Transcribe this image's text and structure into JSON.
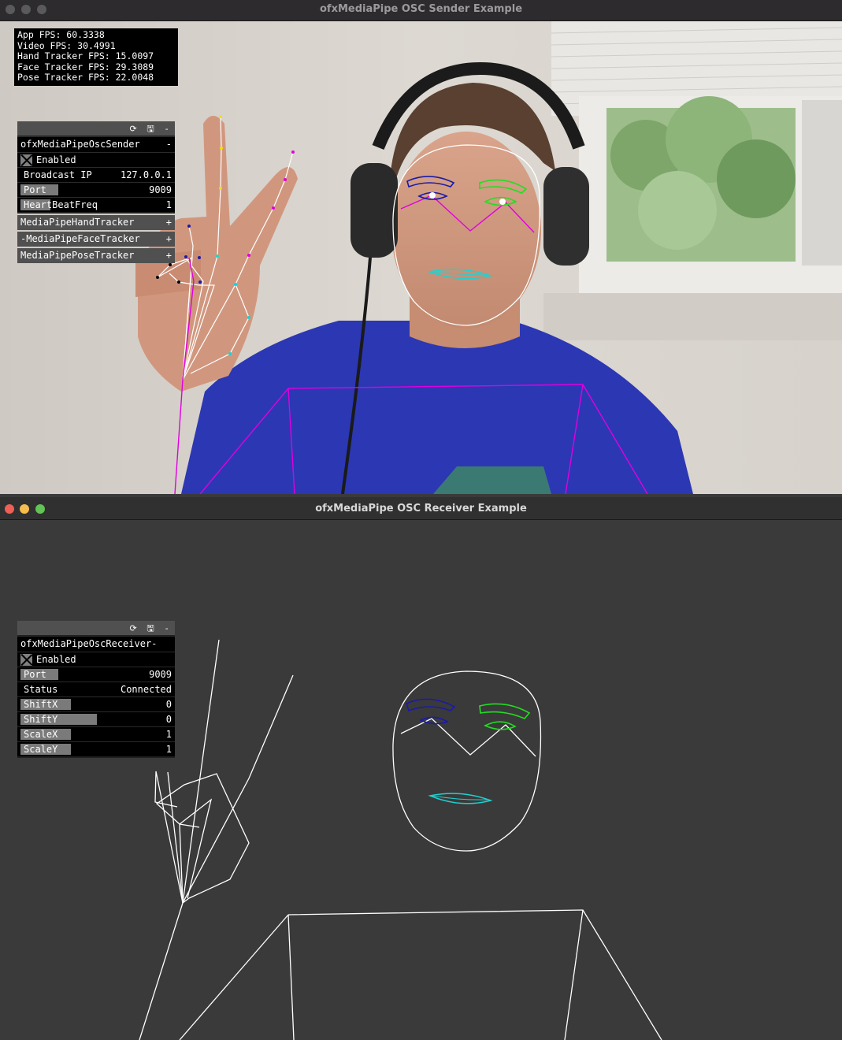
{
  "sender": {
    "title": "ofxMediaPipe OSC Sender Example",
    "fps": [
      "App FPS: 60.3338",
      "Video FPS: 30.4991",
      "Hand Tracker FPS: 15.0097",
      "Face Tracker FPS: 29.3089",
      "Pose Tracker FPS: 22.0048"
    ],
    "gui": {
      "header_icons": "⟳ 🖫 -",
      "panel_name": "ofxMediaPipeOscSender",
      "panel_mark": "-",
      "enabled_label": "Enabled",
      "broadcast_label": "Broadcast IP",
      "broadcast_value": "127.0.0.1",
      "port_label": "Port",
      "port_value": "9009",
      "heartbeat_label": "HeartBeatFreq",
      "heartbeat_value": "1",
      "groups": [
        {
          "label": "MediaPipeHandTracker",
          "mark": "+"
        },
        {
          "label": "-MediaPipeFaceTracker",
          "mark": "+"
        },
        {
          "label": "MediaPipePoseTracker",
          "mark": "+"
        }
      ]
    }
  },
  "receiver": {
    "title": "ofxMediaPipe OSC Receiver Example",
    "gui": {
      "header_icons": "⟳ 🖫 -",
      "panel_name": "ofxMediaPipeOscReceiver-",
      "enabled_label": "Enabled",
      "port_label": "Port",
      "port_value": "9009",
      "status_label": "Status",
      "status_value": "Connected",
      "shiftx_label": "ShiftX",
      "shiftx_value": "0",
      "shifty_label": "ShiftY",
      "shifty_value": "0",
      "scalex_label": "ScaleX",
      "scalex_value": "1",
      "scaley_label": "ScaleY",
      "scaley_value": "1"
    }
  },
  "colors": {
    "close": "#ee5f57",
    "minimize": "#f5bd4f",
    "maximize": "#61c454",
    "inactive_light": "#5a5a5a",
    "pose": "#e000e0",
    "left_brow": "#1a1aa8",
    "right_brow": "#22dd22",
    "lips": "#22d0d0"
  }
}
